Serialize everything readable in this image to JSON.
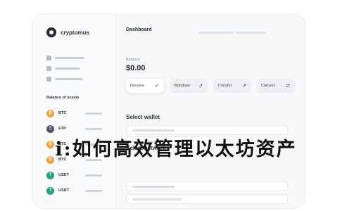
{
  "app": {
    "brand": "cryptomus"
  },
  "sidebar": {
    "section_title": "Balance of assets",
    "assets": [
      {
        "symbol": "BTC",
        "name": "BTC",
        "color": "#f4a13a",
        "glyph": "₿"
      },
      {
        "symbol": "ETH",
        "name": "ETH",
        "color": "#4b5563",
        "glyph": "Ξ"
      },
      {
        "symbol": "BTC",
        "name": "BTC",
        "color": "#f4a13a",
        "glyph": "₿"
      },
      {
        "symbol": "BTC",
        "name": "BTC",
        "color": "#f4a13a",
        "glyph": "₿"
      },
      {
        "symbol": "USDT",
        "name": "USDT",
        "color": "#26a17b",
        "glyph": "T"
      },
      {
        "symbol": "USDT",
        "name": "USDT",
        "color": "#26a17b",
        "glyph": "T"
      }
    ]
  },
  "main": {
    "title": "Dashboard",
    "balance_label": "Balance",
    "balance_value": "$0.00",
    "actions": [
      {
        "label": "Receive",
        "icon": "check-icon",
        "active": true
      },
      {
        "label": "Withdraw",
        "icon": "arrow-icon",
        "active": false
      },
      {
        "label": "Transfer",
        "icon": "arrow-icon",
        "active": false
      },
      {
        "label": "Convert",
        "icon": "arrow-icon",
        "active": false
      }
    ],
    "select_wallet": {
      "heading": "Select wallet",
      "placeholder": ""
    },
    "select_network": {
      "heading": "Select network"
    }
  },
  "overlay": {
    "text": "i:如何高效管理以太坊资产"
  }
}
